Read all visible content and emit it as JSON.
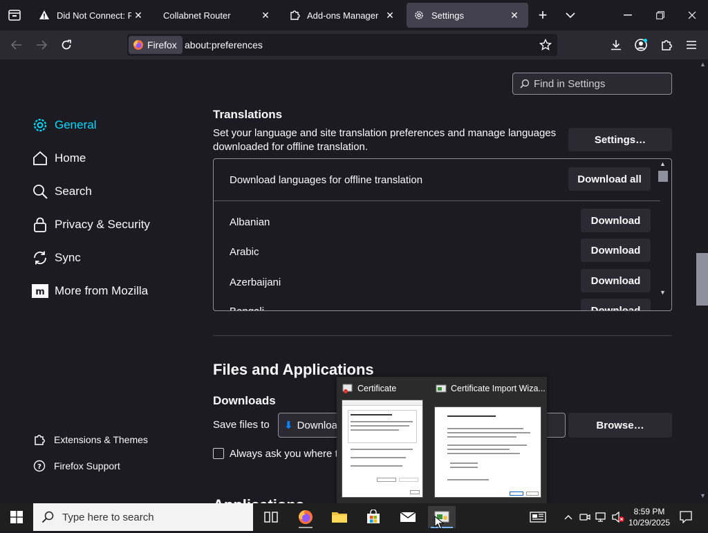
{
  "tabs": [
    {
      "label": "Did Not Connect: Poter",
      "icon": "warning-icon",
      "selected": false
    },
    {
      "label": "Collabnet Router",
      "icon": "",
      "selected": false
    },
    {
      "label": "Add-ons Manager",
      "icon": "puzzle-icon",
      "selected": false
    },
    {
      "label": "Settings",
      "icon": "gear-icon",
      "selected": true
    }
  ],
  "urlbar": {
    "identity_label": "Firefox",
    "url": "about:preferences"
  },
  "search": {
    "placeholder": "Find in Settings"
  },
  "sidebar": {
    "items": [
      {
        "label": "General",
        "icon": "gear-icon",
        "selected": true
      },
      {
        "label": "Home",
        "icon": "home-icon"
      },
      {
        "label": "Search",
        "icon": "search-icon"
      },
      {
        "label": "Privacy & Security",
        "icon": "lock-icon"
      },
      {
        "label": "Sync",
        "icon": "sync-icon"
      },
      {
        "label": "More from Mozilla",
        "icon": "mozilla-icon"
      }
    ],
    "footer": [
      {
        "label": "Extensions & Themes",
        "icon": "puzzle-icon"
      },
      {
        "label": "Firefox Support",
        "icon": "help-icon"
      }
    ]
  },
  "translations": {
    "heading": "Translations",
    "description": "Set your language and site translation preferences and manage languages downloaded for offline translation.",
    "settings_button": "Settings…",
    "box_header": "Download languages for offline translation",
    "download_all": "Download all",
    "languages": [
      {
        "name": "Albanian",
        "button": "Download"
      },
      {
        "name": "Arabic",
        "button": "Download"
      },
      {
        "name": "Azerbaijani",
        "button": "Download"
      },
      {
        "name": "Bengali",
        "button": "Download"
      }
    ]
  },
  "files": {
    "heading": "Files and Applications",
    "downloads_heading": "Downloads",
    "save_files_label": "Save files to",
    "save_folder": "Downloads",
    "browse_button": "Browse…",
    "always_ask": "Always ask you where to save files",
    "applications_heading": "Applications"
  },
  "taskbar": {
    "search_placeholder": "Type here to search",
    "time": "8:59 PM",
    "date": "10/29/2025"
  },
  "preview": {
    "windows": [
      {
        "title": "Certificate"
      },
      {
        "title": "Certificate Import Wiza..."
      }
    ]
  },
  "colors": {
    "accent": "#00ddff",
    "background": "#1c1b22",
    "surface": "#2b2a33"
  }
}
